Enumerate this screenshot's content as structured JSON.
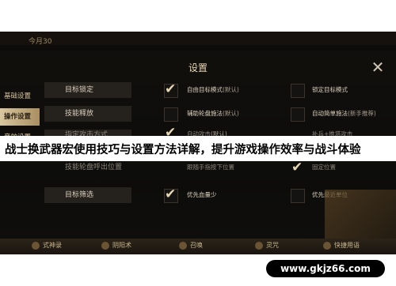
{
  "top_hint": "今月30",
  "settings": {
    "title": "设置",
    "close_icon": "close-icon",
    "sidebar": [
      {
        "label": "基础设置",
        "active": false
      },
      {
        "label": "操作设置",
        "active": true
      },
      {
        "label": "音效设置",
        "active": false
      }
    ],
    "rows": [
      {
        "label": "目标锁定",
        "opt1": "自由目标模式",
        "opt1_sub": "(默认)",
        "opt1_checked": true,
        "opt2": "锁定目标模式",
        "opt2_sub": "",
        "opt2_checked": false
      },
      {
        "label": "技能释放",
        "opt1": "辅助轮盘施法",
        "opt1_sub": "(默认)",
        "opt1_checked": false,
        "opt2": "自动简单施法",
        "opt2_sub": "(新手推荐)",
        "opt2_checked": false
      },
      {
        "label": "指定攻击方式",
        "opt1": "自动攻击",
        "opt1_sub": "(默认)",
        "opt1_checked": true,
        "opt2": "补兵+推塔攻击",
        "opt2_sub": "",
        "opt2_checked": false
      },
      {
        "label": "技能轮盘呼出位置",
        "opt1": "跟随手指按下位置",
        "opt1_sub": "",
        "opt1_checked": false,
        "opt2": "固定位置",
        "opt2_sub": "",
        "opt2_checked": true
      },
      {
        "label": "目标筛选",
        "opt1": "优先血量少",
        "opt1_sub": "",
        "opt1_checked": true,
        "opt2": "优先最近单位",
        "opt2_sub": "",
        "opt2_checked": false
      }
    ]
  },
  "banner_text": "战士换武器宏使用技巧与设置方法详解，提升游戏操作效率与战斗体验",
  "bottom_bar": [
    "式神录",
    "阴阳术",
    "召唤",
    "灵咒",
    "快捷用语"
  ],
  "watermark": "www.gkjz66.com"
}
